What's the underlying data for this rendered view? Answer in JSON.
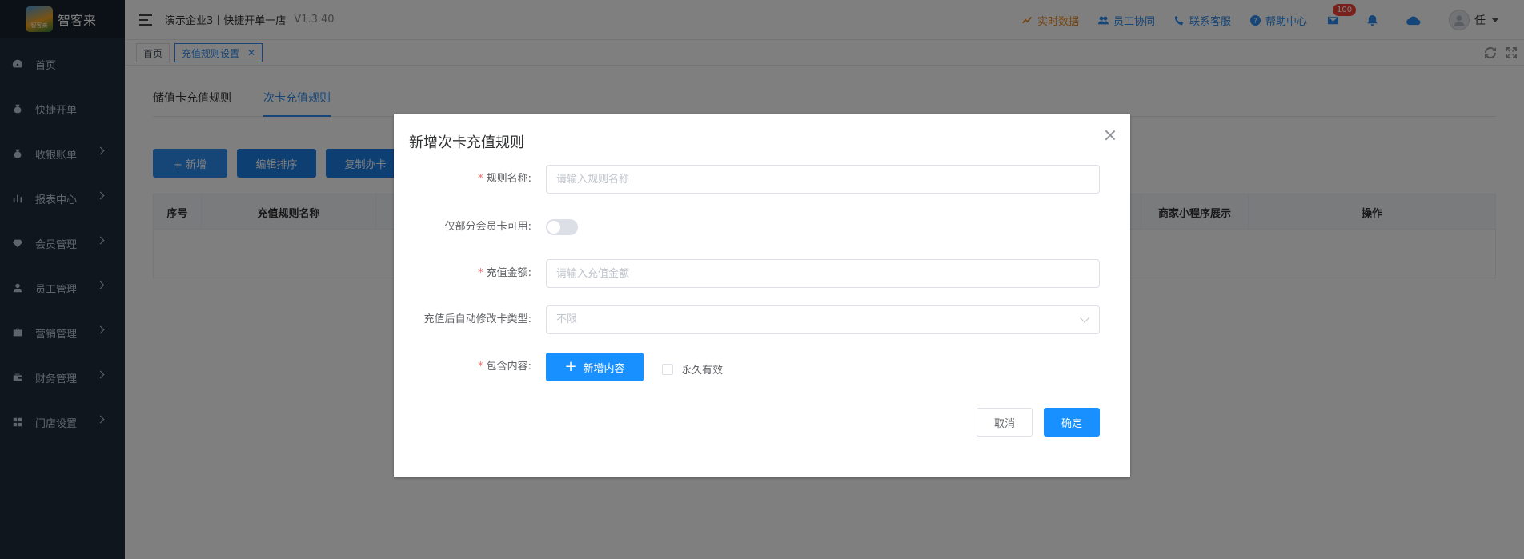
{
  "app": {
    "logo_text": "智客来",
    "logo_small": "智客来"
  },
  "sidebar": {
    "items": [
      {
        "label": "首页",
        "icon": "dashboard-icon",
        "has_submenu": false
      },
      {
        "label": "快捷开单",
        "icon": "money-bag-icon",
        "has_submenu": false
      },
      {
        "label": "收银账单",
        "icon": "money-bag-icon",
        "has_submenu": true
      },
      {
        "label": "报表中心",
        "icon": "bar-chart-icon",
        "has_submenu": true
      },
      {
        "label": "会员管理",
        "icon": "diamond-icon",
        "has_submenu": true
      },
      {
        "label": "员工管理",
        "icon": "user-icon",
        "has_submenu": true
      },
      {
        "label": "营销管理",
        "icon": "briefcase-icon",
        "has_submenu": true
      },
      {
        "label": "财务管理",
        "icon": "wallet-icon",
        "has_submenu": true
      },
      {
        "label": "门店设置",
        "icon": "grid-icon",
        "has_submenu": true
      }
    ]
  },
  "header": {
    "title": "演示企业3丨快捷开单一店",
    "version": "V1.3.40",
    "links": {
      "realtime": "实时数据",
      "staff": "员工协同",
      "service": "联系客服",
      "help": "帮助中心"
    },
    "mail_badge": "100",
    "user_name": "任"
  },
  "tagsbar": {
    "home": "首页",
    "current": "充值规则设置"
  },
  "main": {
    "tabs": [
      "储值卡充值规则",
      "次卡充值规则"
    ],
    "buttons": {
      "add": "+  新增",
      "sort": "编辑排序",
      "copy": "复制办卡"
    },
    "table_headers": [
      "序号",
      "充值规则名称",
      "商家小程序展示",
      "操作"
    ]
  },
  "dialog": {
    "title": "新增次卡充值规则",
    "fields": {
      "name_label": "规则名称:",
      "name_placeholder": "请输入规则名称",
      "partial_label": "仅部分会员卡可用:",
      "amount_label": "充值金额:",
      "amount_placeholder": "请输入充值金额",
      "type_label": "充值后自动修改卡类型:",
      "type_value": "不限",
      "content_label": "包含内容:",
      "add_content": "新增内容",
      "forever": "永久有效"
    },
    "cancel": "取消",
    "ok": "确定"
  },
  "colors": {
    "primary": "#1890ff",
    "sidebar_bg": "#1f2d3d",
    "required": "#f56c6c",
    "realtime": "#e6891e"
  }
}
